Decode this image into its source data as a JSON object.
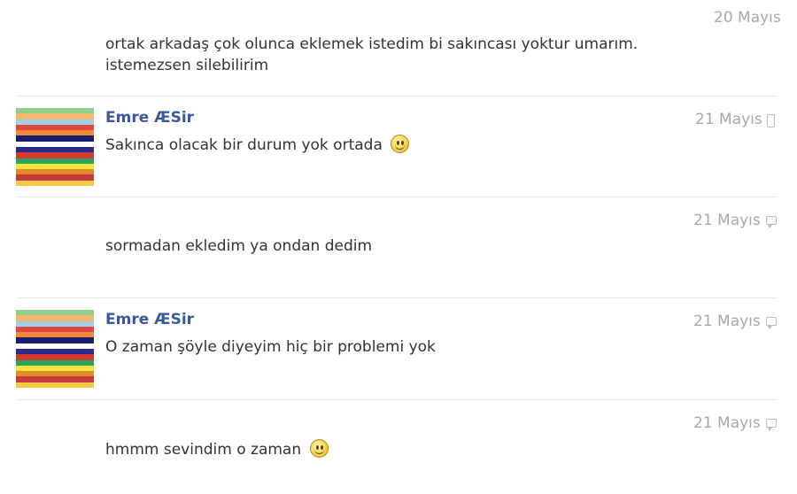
{
  "colors": {
    "sender": "#3b5998",
    "text": "#333333",
    "date": "#a7a9ac",
    "separator": "#e6e9ef",
    "avatar_stripes": [
      "#8fcf8b",
      "#f2b86f",
      "#a3d0e6",
      "#e0473e",
      "#f08a3a",
      "#1c1c6e",
      "#ffffff",
      "#2a2a8c",
      "#d4392f",
      "#27a65a",
      "#f7e43f",
      "#e08c2a",
      "#c43b3b",
      "#f4c842"
    ]
  },
  "messages": [
    {
      "date": "20 Mayıs",
      "lines": [
        "ortak arkadaş çok olunca eklemek istedim bi sakıncası yoktur umarım.",
        "istemezsen silebilirim"
      ]
    },
    {
      "sender": "Emre ÆSir",
      "date": "21 Mayıs",
      "date_icon": "phone-icon",
      "lines": [
        "Sakınca olacak bir durum yok ortada"
      ],
      "emoji": "smiley-icon"
    },
    {
      "date": "21 Mayıs",
      "date_icon": "chat-icon",
      "lines": [
        "sormadan ekledim ya ondan dedim"
      ]
    },
    {
      "sender": "Emre ÆSir",
      "date": "21 Mayıs",
      "date_icon": "chat-icon",
      "lines": [
        "O zaman şöyle diyeyim hiç bir problemi yok"
      ]
    },
    {
      "date": "21 Mayıs",
      "date_icon": "chat-icon",
      "lines": [
        "hmmm sevindim o zaman"
      ],
      "emoji": "smiley-icon"
    }
  ]
}
